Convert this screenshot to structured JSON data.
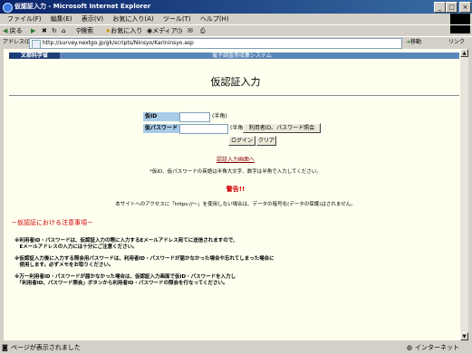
{
  "window": {
    "title": "仮認証入力 - Microsoft Internet Explorer"
  },
  "menu": [
    "ファイル(F)",
    "編集(E)",
    "表示(V)",
    "お気に入り(A)",
    "ツール(T)",
    "ヘルプ(H)"
  ],
  "toolbar": {
    "back": "戻る",
    "search": "検索",
    "favorites": "お気に入り",
    "media": "メディア"
  },
  "address": {
    "label": "アドレス(D)",
    "url": "http://survey.nextgo.jp/gk/scripts/Ninsyo/Karininsyo.asp",
    "go": "移動",
    "links": "リンク"
  },
  "header": {
    "org": "文部科学省",
    "system": "電子調査票収集システム"
  },
  "page": {
    "title": "仮認証入力"
  },
  "form": {
    "id_label": "仮ID",
    "id_hint": "(半角)",
    "pw_label": "仮パスワード",
    "pw_hint": "(半角)",
    "inquiry_button": "利用者ID、パスワード照会",
    "login_button": "ログイン",
    "clear_button": "クリア"
  },
  "links": {
    "auth_page": "認証入力画面へ"
  },
  "notes": {
    "input_note": "*仮ID、仮パスワードの英語は半角大文字、数字は半角で入力してください。",
    "warning_title": "警告!!",
    "warning_text": "本サイトへのアクセスに「https://～」を使用しない場合は、データの暗号化(データの保護)はされません。"
  },
  "cautions": {
    "title": "－仮認証における注意事項－",
    "items": [
      "※利用者ID・パスワードは、仮認証入力の際に入力するEメールアドレス宛てに送信されますので、",
      "　Eメールアドレスの入力には十分にご注意ください。",
      "※仮認証入力後に入力する照会用パスワードは、利用者ID・パスワードが届かなかった場合や忘れてしまった場合に",
      "　使用します。必ずメモをお取りください。",
      "※万一利用者ID・パスワードが届かなかった場合は、仮認証入力画面で仮ID・パスワードを入力し",
      "　「利用者ID、パスワード照会」ボタンから利用者ID・パスワードの照会を行なってください。"
    ]
  },
  "status": {
    "text": "ページが表示されました",
    "zone": "インターネット"
  }
}
